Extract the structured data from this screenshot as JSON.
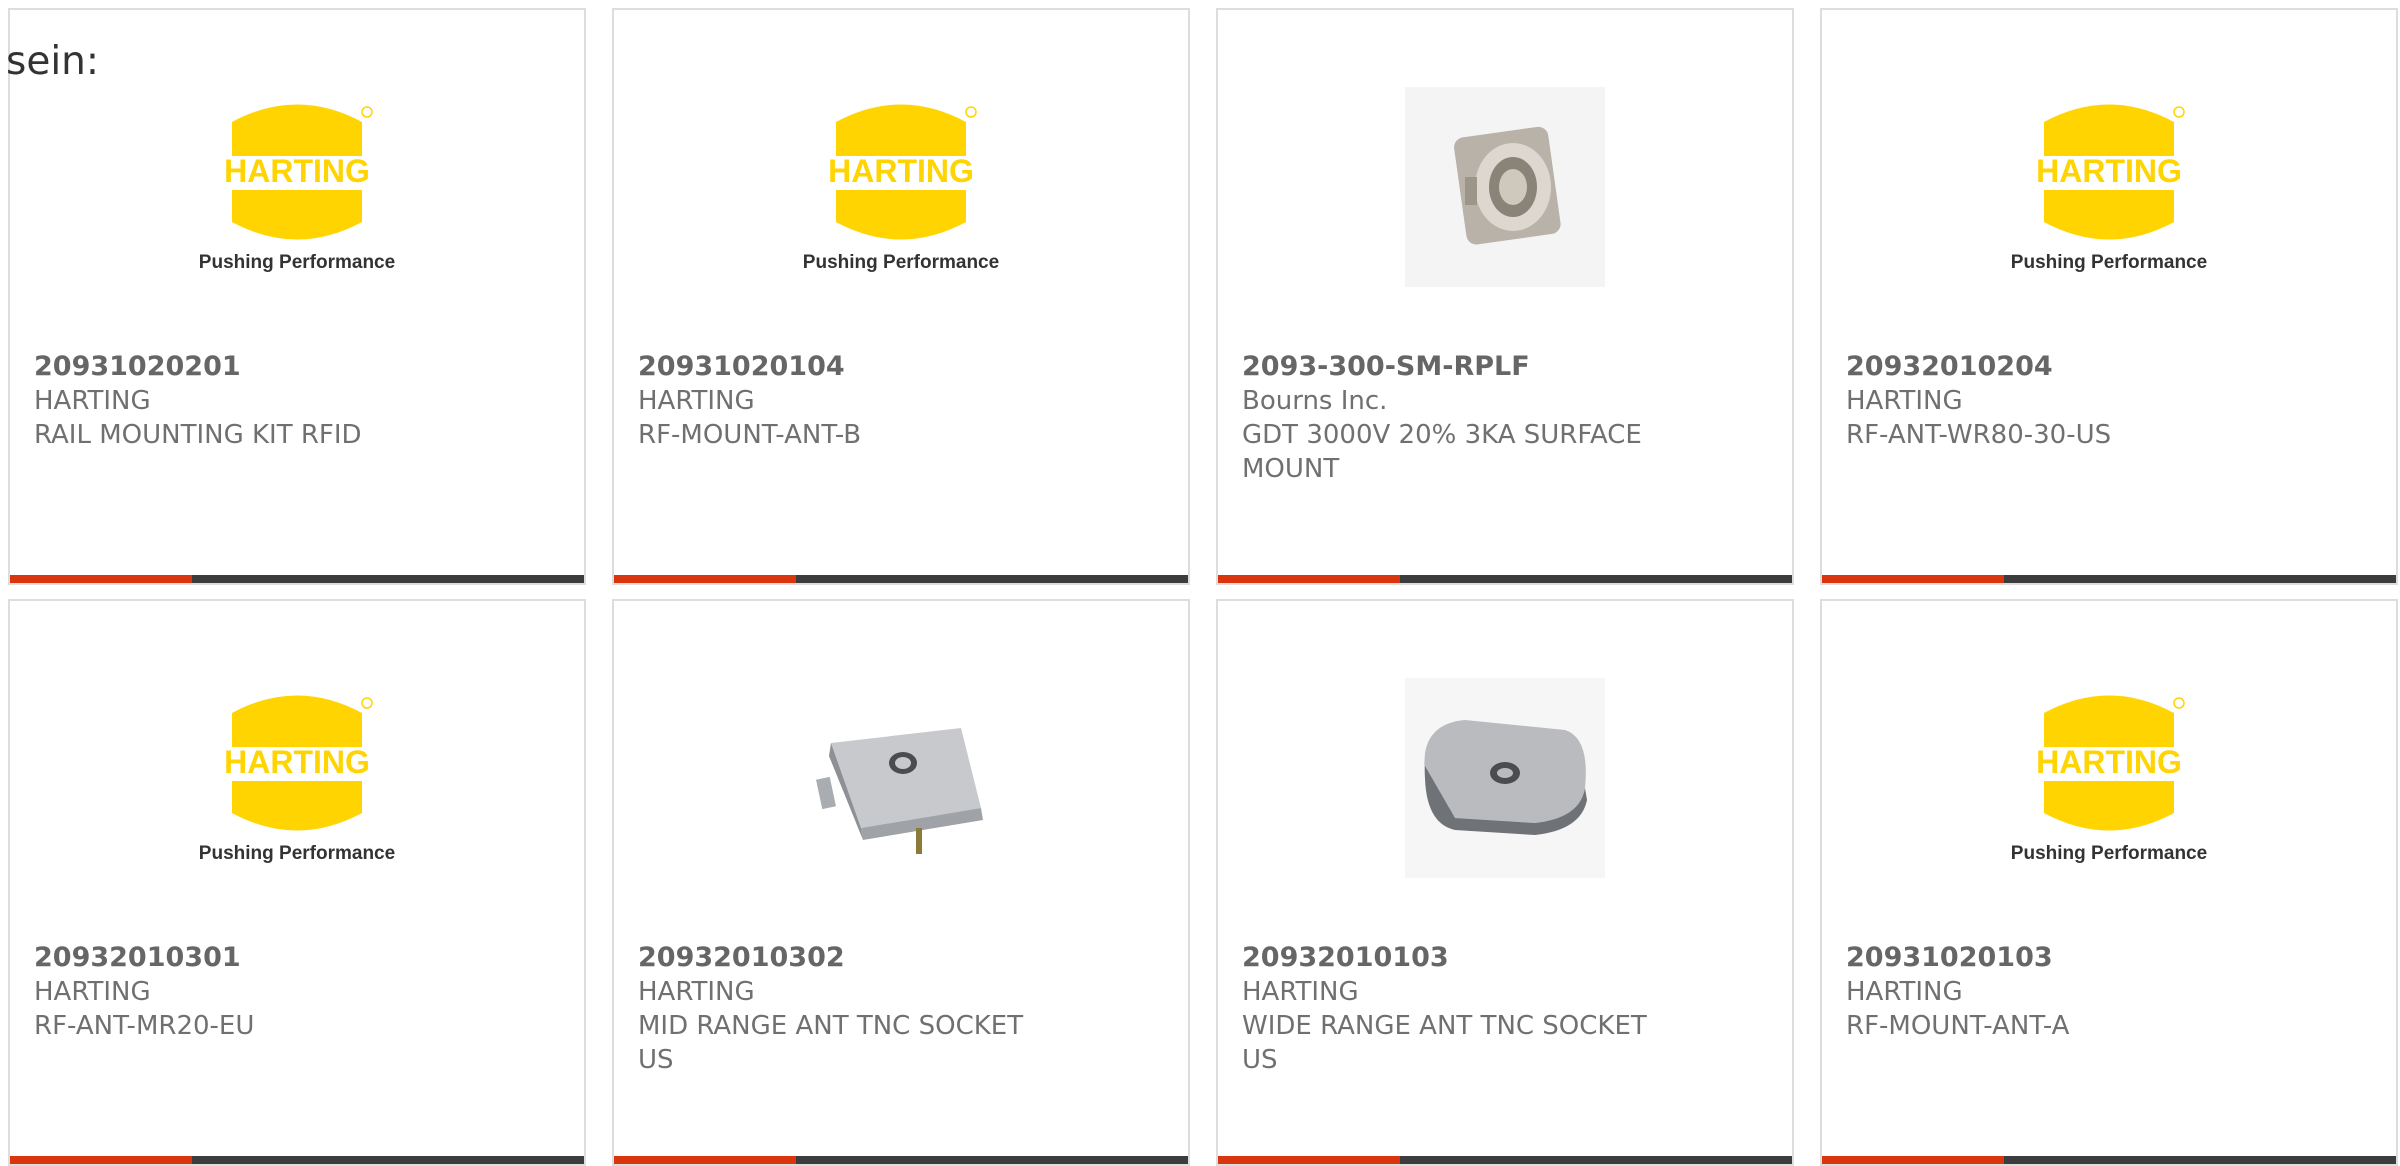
{
  "intro_text": "sein:",
  "logo": {
    "brand_text": "HARTING",
    "tagline": "Pushing Performance",
    "color": "#ffd400"
  },
  "colors": {
    "accent_bar": "#d9360f",
    "bar": "#3c3c3c",
    "text": "#707070"
  },
  "products": [
    {
      "part_number": "20931020201",
      "manufacturer": "HARTING",
      "description": "RAIL MOUNTING KIT RFID",
      "image": "harting-logo"
    },
    {
      "part_number": "20931020104",
      "manufacturer": "HARTING",
      "description": "RF-MOUNT-ANT-B",
      "image": "harting-logo"
    },
    {
      "part_number": "2093-300-SM-RPLF",
      "manufacturer": "Bourns Inc.",
      "description": "GDT 3000V 20% 3KA SURFACE MOUNT",
      "image": "gas-discharge-tube"
    },
    {
      "part_number": "20932010204",
      "manufacturer": "HARTING",
      "description": "RF-ANT-WR80-30-US",
      "image": "harting-logo"
    },
    {
      "part_number": "20932010301",
      "manufacturer": "HARTING",
      "description": "RF-ANT-MR20-EU",
      "image": "harting-logo"
    },
    {
      "part_number": "20932010302",
      "manufacturer": "HARTING",
      "description": "MID RANGE ANT TNC SOCKET US",
      "image": "antenna-mid-range"
    },
    {
      "part_number": "20932010103",
      "manufacturer": "HARTING",
      "description": "WIDE RANGE ANT TNC SOCKET US",
      "image": "antenna-wide-range"
    },
    {
      "part_number": "20931020103",
      "manufacturer": "HARTING",
      "description": "RF-MOUNT-ANT-A",
      "image": "harting-logo"
    }
  ]
}
